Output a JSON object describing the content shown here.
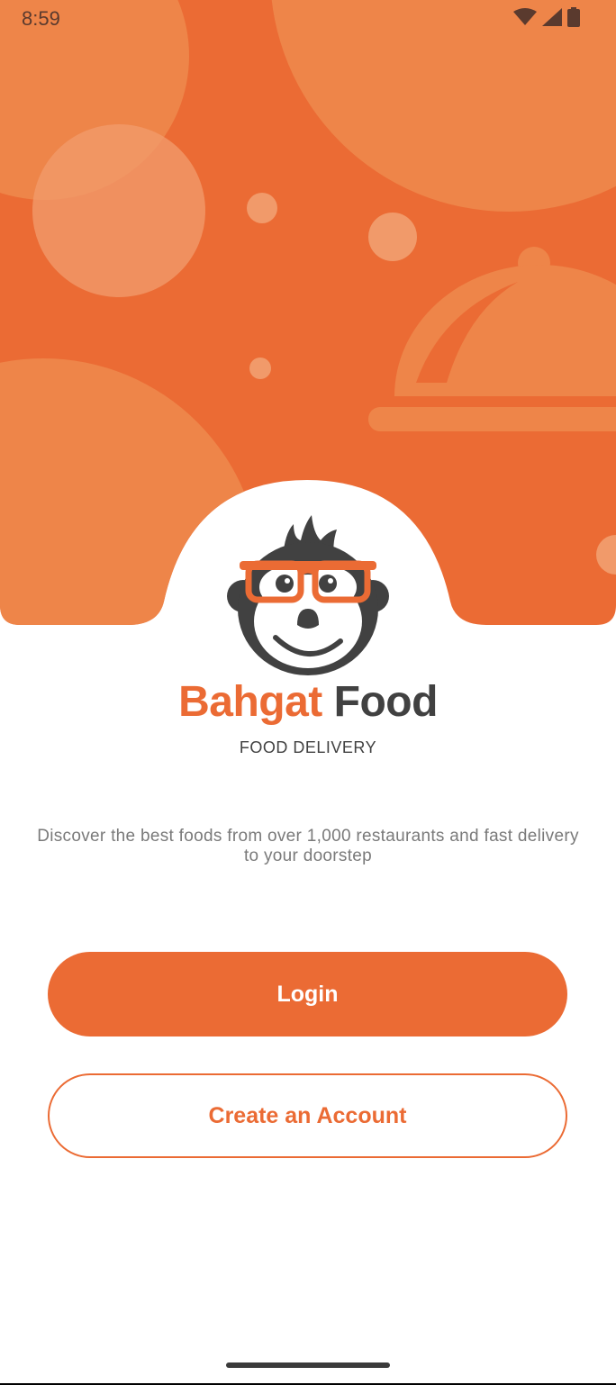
{
  "status_bar": {
    "time": "8:59"
  },
  "brand": {
    "name_part1": "Bahgat",
    "name_part2": "Food",
    "tagline": "FOOD DELIVERY"
  },
  "description": "Discover the best foods from over 1,000 restaurants and fast delivery to your doorstep",
  "actions": {
    "login_label": "Login",
    "create_account_label": "Create an Account"
  },
  "colors": {
    "accent": "#eb6b34",
    "accent_light": "#f0884d",
    "dark": "#414141",
    "muted_text": "#7a7a7a",
    "background": "#ffffff"
  },
  "icons": [
    "wifi-icon",
    "signal-icon",
    "battery-icon",
    "monkey-logo",
    "food-cloche-icon"
  ]
}
